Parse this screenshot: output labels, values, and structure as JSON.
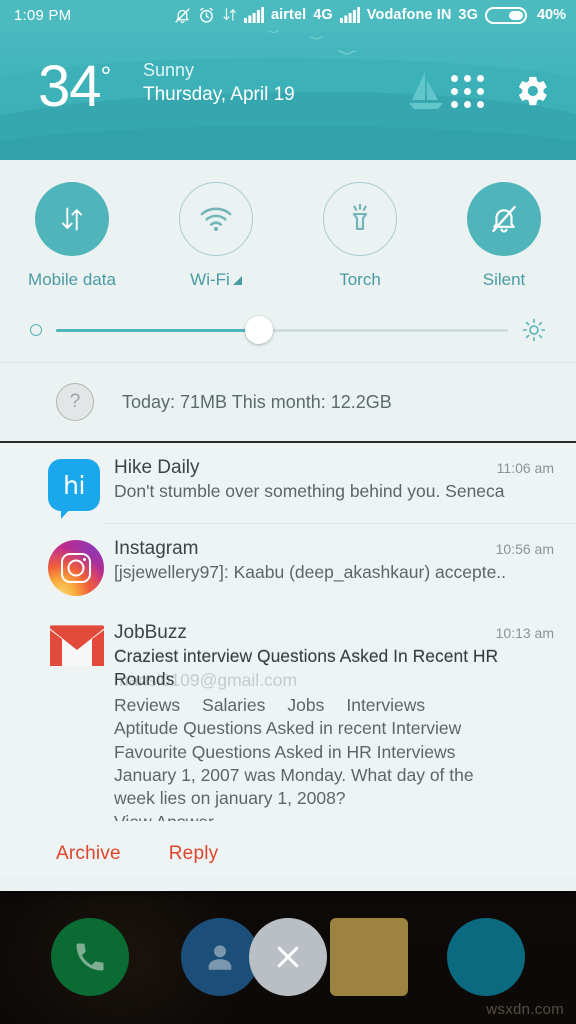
{
  "statusbar": {
    "time": "1:09 PM",
    "icons": [
      "bell-muted-icon",
      "alarm-icon",
      "data-transfer-icon",
      "signal-bars-icon"
    ],
    "carrier1": "airtel",
    "network1": "4G",
    "carrier2": "Vodafone IN",
    "network2": "3G",
    "battery_percent": "40%",
    "battery_level": 40
  },
  "weather": {
    "temperature": "34",
    "degree_symbol": "°",
    "condition": "Sunny",
    "date": "Thursday, April 19",
    "apps_icon": "grid-apps-icon",
    "settings_icon": "gear-icon"
  },
  "quick_settings": {
    "toggles": [
      {
        "label": "Mobile data",
        "icon": "data-arrows-icon",
        "state": "on"
      },
      {
        "label": "Wi-Fi",
        "icon": "wifi-icon",
        "state": "off",
        "has_triangle": true
      },
      {
        "label": "Torch",
        "icon": "torch-icon",
        "state": "off"
      },
      {
        "label": "Silent",
        "icon": "bell-muted-icon",
        "state": "on"
      }
    ]
  },
  "brightness": {
    "low_icon": "brightness-low-icon",
    "high_icon": "brightness-high-icon",
    "value": 45
  },
  "data_usage": {
    "help_icon": "question-mark-icon",
    "text": "Today: 71MB   This month: 12.2GB"
  },
  "notifications": [
    {
      "app": "Hike Daily",
      "time": "11:06 am",
      "message": "Don't stumble over something behind you. Seneca",
      "icon": "hike-icon",
      "icon_text": "hi"
    },
    {
      "app": "Instagram",
      "time": "10:56 am",
      "message": "[jsjewellery97]: Kaabu (deep_akashkaur) accepte..",
      "icon": "instagram-icon"
    },
    {
      "app": "JobBuzz",
      "time": "10:13 am",
      "icon": "gmail-icon",
      "ghost_subject": "Craziest interview Questions Asked In Recent HR",
      "ghost_sender": "mansi0109@gmail.com",
      "subject": "Craziest interview Questions Asked In Recent HR Rounds",
      "nav_links": [
        "Reviews",
        "Salaries",
        "Jobs",
        "Interviews"
      ],
      "body_lines": [
        "Aptitude Questions Asked in recent Interview",
        "Favourite Questions Asked in HR Interviews",
        "January 1, 2007 was Monday. What day of the",
        "week lies on january 1, 2008?"
      ],
      "truncated_line": "View Answer",
      "actions": [
        "Archive",
        "Reply"
      ]
    }
  ],
  "dock": {
    "buttons": [
      {
        "name": "phone",
        "icon": "phone-icon",
        "color": "#0a6b33"
      },
      {
        "name": "contacts",
        "icon": "person-icon",
        "color": "#1b4f7a"
      },
      {
        "name": "clear-all",
        "icon": "close-icon",
        "color": "#b9bfc4"
      },
      {
        "name": "mail",
        "icon": "envelope-icon",
        "color": "#9d8340"
      },
      {
        "name": "messaging",
        "icon": "chat-bubble-icon",
        "color": "#0b6a80"
      }
    ]
  },
  "watermark": "wsxdn.com",
  "colors": {
    "accent_teal": "#4cbbbf",
    "header_teal": "#48b9be",
    "shade_bg": "#eaf2f2",
    "action_red": "#e0452c",
    "label_teal": "#4a9ba3"
  }
}
